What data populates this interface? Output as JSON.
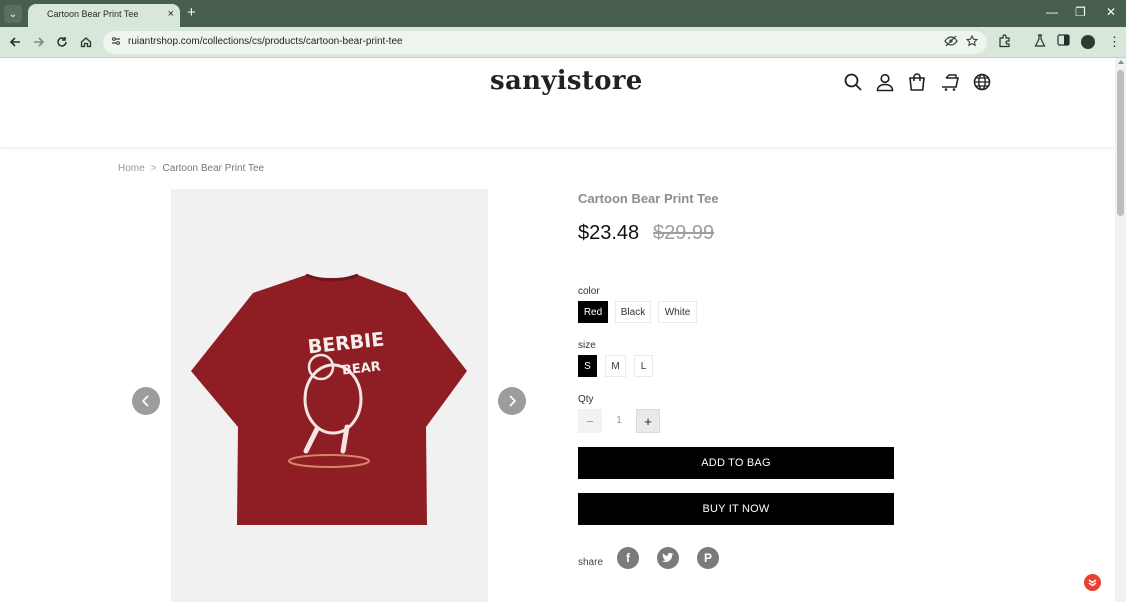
{
  "browser": {
    "tab_title": "Cartoon Bear Print Tee",
    "tab_close": "×",
    "new_tab": "+",
    "url": "ruiantrshop.com/collections/cs/products/cartoon-bear-print-tee",
    "window_controls": {
      "minimize": "—",
      "maximize": "❐",
      "close": "✕"
    },
    "chrome_color": "#485e4f",
    "toolbar_color": "#d8e7da"
  },
  "site": {
    "logo": "sanyistore",
    "header_icons": [
      "search-icon",
      "account-icon",
      "bag-icon",
      "cart-icon",
      "globe-icon"
    ]
  },
  "breadcrumb": {
    "home": "Home",
    "separator": ">",
    "current": "Cartoon Bear Print Tee"
  },
  "product": {
    "title": "Cartoon Bear Print Tee",
    "price": "$23.48",
    "compare_price": "$29.99",
    "image_color": "#8e1d24",
    "image_print_text_1": "BERBIE",
    "image_print_text_2": "BEAR"
  },
  "options": {
    "color": {
      "label": "color",
      "values": [
        "Red",
        "Black",
        "White"
      ],
      "selected": "Red"
    },
    "size": {
      "label": "size",
      "values": [
        "S",
        "M",
        "L"
      ],
      "selected": "S"
    }
  },
  "quantity": {
    "label": "Qty",
    "value": "1",
    "minus": "−",
    "plus": "+"
  },
  "actions": {
    "add_to_bag": "ADD TO BAG",
    "buy_now": "BUY IT NOW"
  },
  "share": {
    "label": "share",
    "networks": [
      "facebook-icon",
      "twitter-icon",
      "pinterest-icon"
    ],
    "facebook_glyph": "f",
    "pinterest_glyph": "P"
  }
}
